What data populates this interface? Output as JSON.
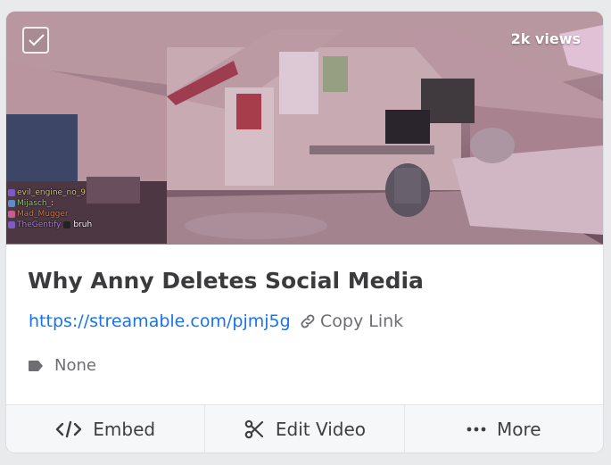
{
  "thumbnail": {
    "views": "2k views",
    "chat": [
      {
        "name": "evil_engine_no_9",
        "text": "",
        "color": "#d8c85a"
      },
      {
        "name": "Mijasch_",
        "text": ":",
        "color": "#8ad06a"
      },
      {
        "name": "Mad_Mugger",
        "text": "",
        "color": "#e07a4a"
      },
      {
        "name": "TheGentify",
        "text": "bruh",
        "color": "#b07aff"
      }
    ]
  },
  "video": {
    "title": "Why Anny Deletes Social Media",
    "url": "https://streamable.com/pjmj5g",
    "copy_label": "Copy Link",
    "tag": "None"
  },
  "actions": {
    "embed": "Embed",
    "edit": "Edit Video",
    "more": "More"
  },
  "colors": {
    "link": "#1a73e8",
    "footer_bg": "#f6f7f8",
    "text": "#3b3b3d"
  }
}
